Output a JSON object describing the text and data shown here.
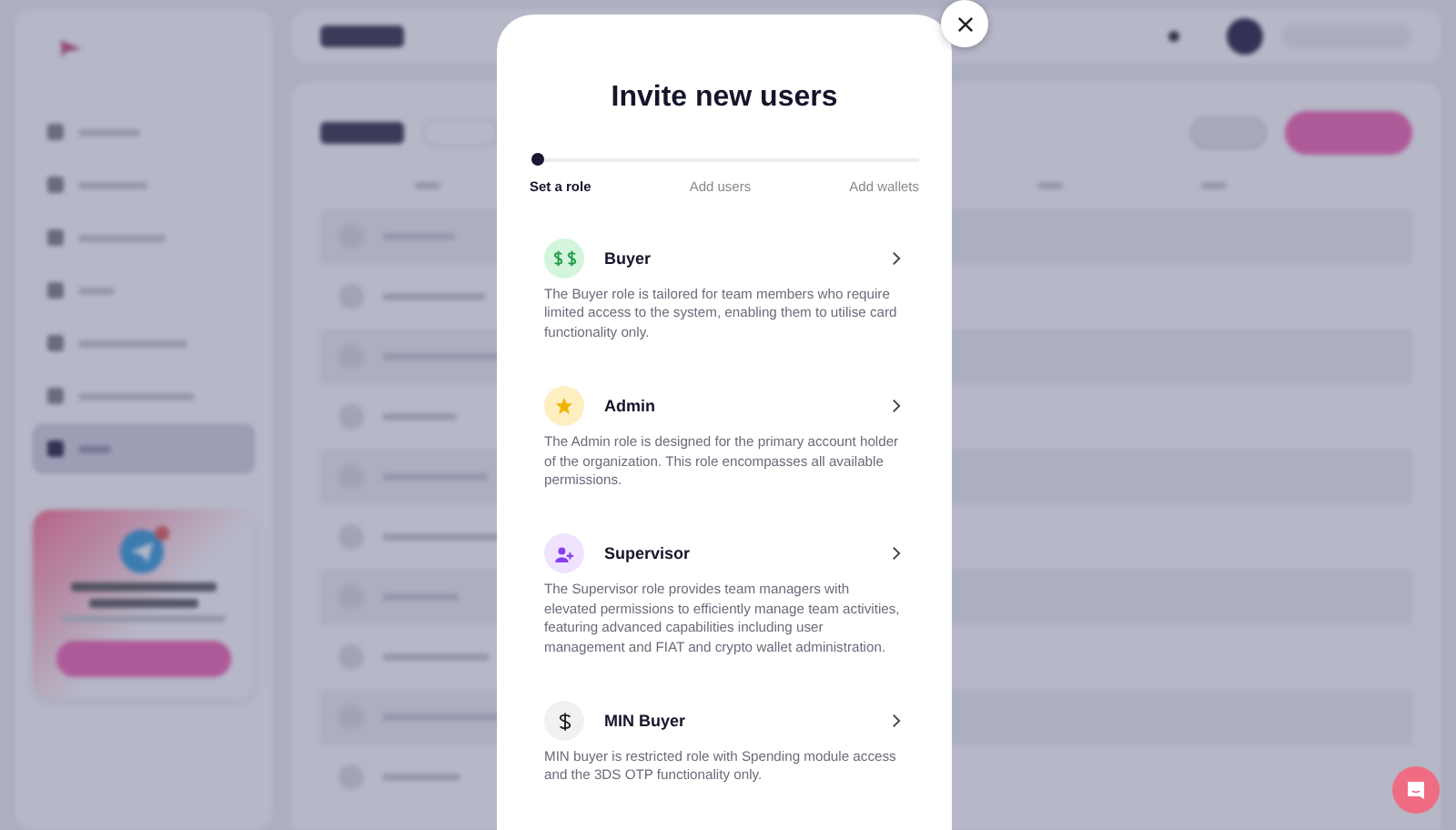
{
  "sidebar": {
    "nav": [
      {
        "selected": false
      },
      {
        "selected": false
      },
      {
        "selected": false
      },
      {
        "selected": false
      },
      {
        "selected": false
      },
      {
        "selected": false
      },
      {
        "selected": true
      }
    ]
  },
  "modal": {
    "title": "Invite new users",
    "steps": [
      {
        "label": "Set a role",
        "selected": true
      },
      {
        "label": "Add users",
        "selected": false
      },
      {
        "label": "Add wallets",
        "selected": false
      }
    ],
    "roles": [
      {
        "kind": "buyer",
        "name": "Buyer",
        "description": "The Buyer role is tailored for team members who require limited access to the system, enabling them to utilise card functionality only."
      },
      {
        "kind": "admin",
        "name": "Admin",
        "description": "The Admin role is designed for the primary account holder of the organization. This role encompasses all available permissions."
      },
      {
        "kind": "supervisor",
        "name": "Supervisor",
        "description": "The Supervisor role provides team managers with elevated permissions to efficiently manage team activities, featuring advanced capabilities including user management and FIAT and crypto wallet administration."
      },
      {
        "kind": "min_buyer",
        "name": "MIN Buyer",
        "description": "MIN buyer is restricted role with Spending module access and the 3DS OTP functionality only."
      }
    ]
  }
}
